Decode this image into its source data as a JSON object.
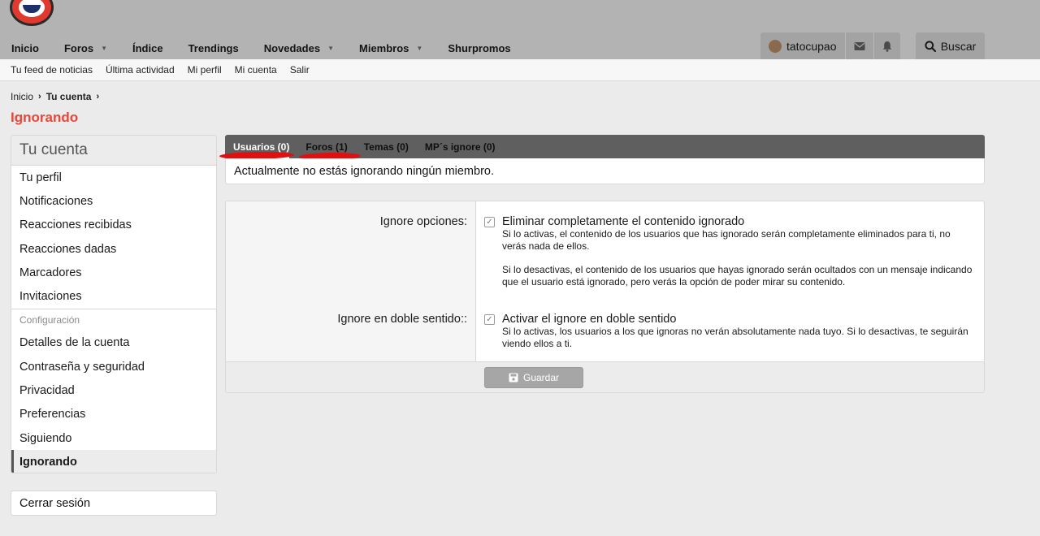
{
  "header": {
    "nav": [
      {
        "label": "Inicio",
        "has_caret": false
      },
      {
        "label": "Foros",
        "has_caret": true
      },
      {
        "label": "Índice",
        "has_caret": false
      },
      {
        "label": "Trendings",
        "has_caret": false
      },
      {
        "label": "Novedades",
        "has_caret": true
      },
      {
        "label": "Miembros",
        "has_caret": true
      },
      {
        "label": "Shurpromos",
        "has_caret": false
      }
    ],
    "username": "tatocupao",
    "search_label": "Buscar"
  },
  "sub_nav": [
    "Tu feed de noticias",
    "Última actividad",
    "Mi perfil",
    "Mi cuenta",
    "Salir"
  ],
  "breadcrumb": {
    "home": "Inicio",
    "current": "Tu cuenta"
  },
  "page_title": "Ignorando",
  "sidebar": {
    "header": "Tu cuenta",
    "items": [
      "Tu perfil",
      "Notificaciones",
      "Reacciones recibidas",
      "Reacciones dadas",
      "Marcadores",
      "Invitaciones"
    ],
    "section_label": "Configuración",
    "settings_items": [
      "Detalles de la cuenta",
      "Contraseña y seguridad",
      "Privacidad",
      "Preferencias",
      "Siguiendo",
      "Ignorando"
    ],
    "logout": "Cerrar sesión"
  },
  "tabs": [
    {
      "label": "Usuarios (0)"
    },
    {
      "label": "Foros (1)"
    },
    {
      "label": "Temas (0)"
    },
    {
      "label": "MP´s ignore (0)"
    }
  ],
  "tab_content": "Actualmente no estás ignorando ningún miembro.",
  "options": {
    "row1_label": "Ignore opciones:",
    "row1_title": "Eliminar completamente el contenido ignorado",
    "row1_hint1": "Si lo activas, el contenido de los usuarios que has ignorado serán completamente eliminados para ti, no verás nada de ellos.",
    "row1_hint2": "Si lo desactivas, el contenido de los usuarios que hayas ignorado serán ocultados con un mensaje indicando que el usuario está ignorado, pero verás la opción de poder mirar su contenido.",
    "row2_label": "Ignore en doble sentido::",
    "row2_title": "Activar el ignore en doble sentido",
    "row2_hint": "Si lo activas, los usuarios a los que ignoras no verán absolutamente nada tuyo. Si lo desactivas, te seguirán viendo ellos a ti.",
    "save_label": "Guardar"
  },
  "colors": {
    "accent": "#e8473a",
    "tab_bar": "#5f5f5f",
    "header_bg": "#b3b3b3"
  }
}
